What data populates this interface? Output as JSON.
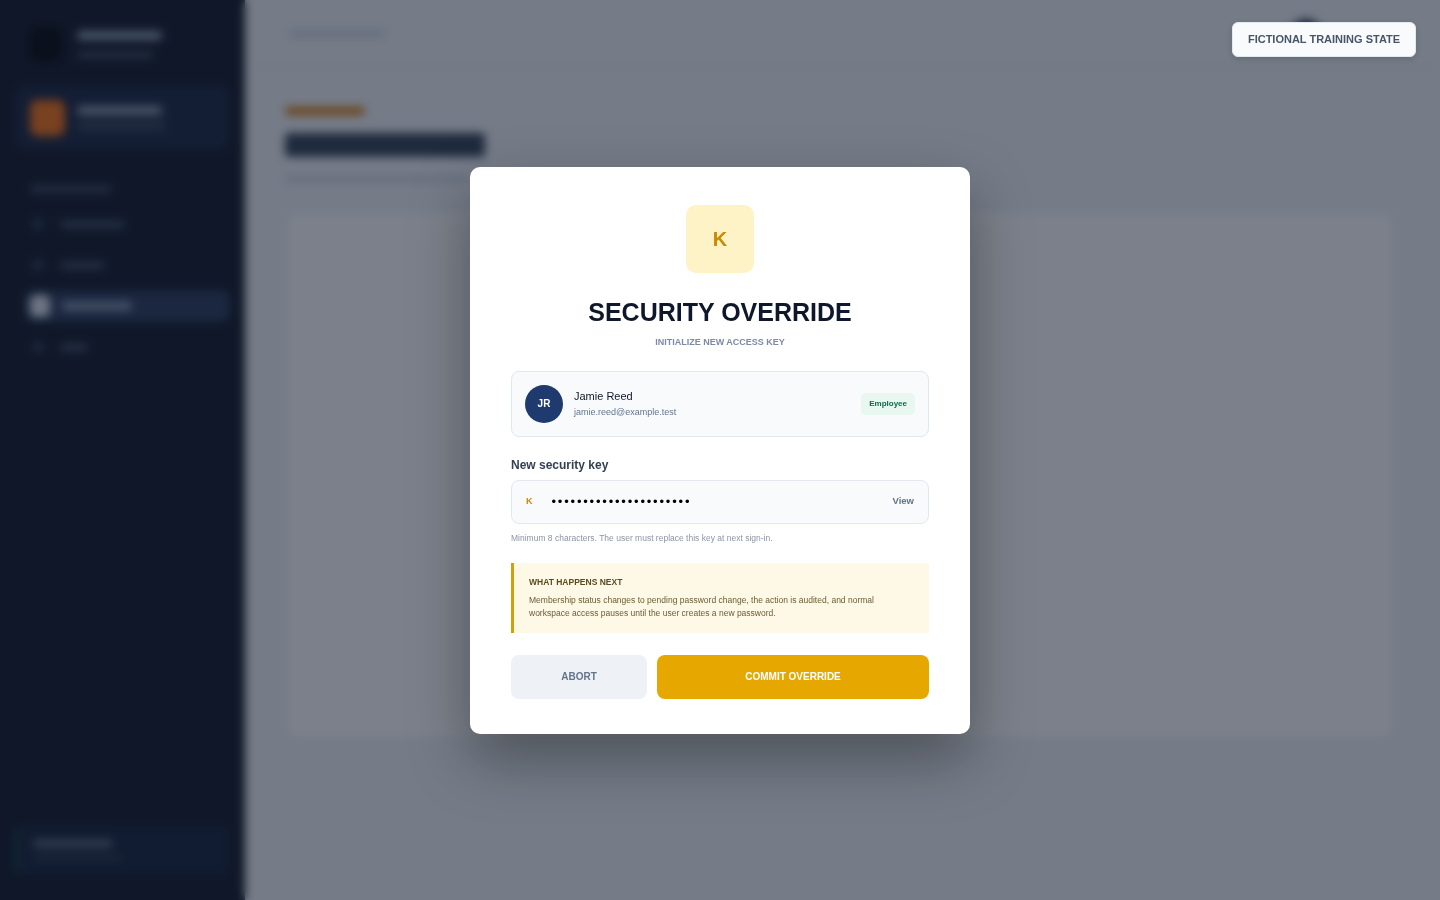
{
  "notice_badge": "FICTIONAL TRAINING STATE",
  "dialog": {
    "icon_letter": "K",
    "title": "SECURITY OVERRIDE",
    "subtitle": "INITIALIZE NEW ACCESS KEY",
    "user": {
      "initials": "JR",
      "name": "Jamie Reed",
      "email": "jamie.reed@example.test",
      "role": "Employee"
    },
    "key_field": {
      "label": "New security key",
      "prefix": "K",
      "value": "••••••••••••••••••••••",
      "toggle": "View",
      "hint": "Minimum 8 characters. The user must replace this key at next sign-in."
    },
    "callout": {
      "title": "WHAT HAPPENS NEXT",
      "text": "Membership status changes to pending password change, the action is audited, and normal workspace access pauses until the user creates a new password."
    },
    "buttons": [
      {
        "label": "ABORT",
        "kind": "secondary"
      },
      {
        "label": "COMMIT OVERRIDE",
        "kind": "primary"
      }
    ]
  }
}
